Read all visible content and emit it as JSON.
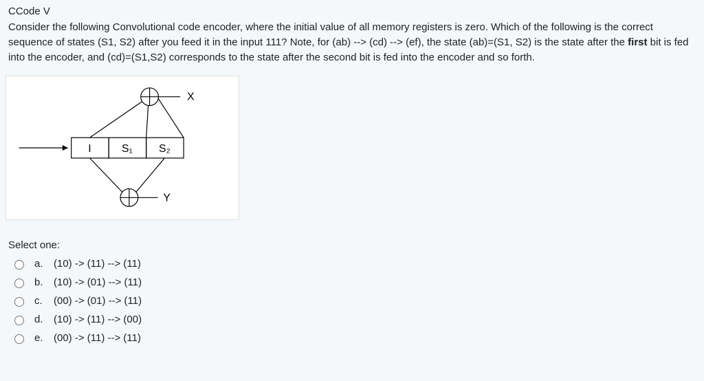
{
  "title": "CCode V",
  "question_html": "Consider the following Convolutional code encoder, where the initial value of all memory registers is zero.  Which of the following is the correct sequence of states (S1, S2) after you feed it in the input 111?   Note, for (ab) --> (cd) --> (ef), the state (ab)=(S1, S2) is the state after the <b>first</b> bit is fed into the encoder, and (cd)=(S1,S2) corresponds to the state after the second bit is fed into the encoder and so forth.",
  "diagram": {
    "input_label": "I",
    "s1_label": "S₁",
    "s2_label": "S₂",
    "x_label": "X",
    "y_label": "Y"
  },
  "select_label": "Select one:",
  "options": [
    {
      "letter": "a.",
      "text": "(10) -> (11) --> (11)"
    },
    {
      "letter": "b.",
      "text": "(10) -> (01) --> (11)"
    },
    {
      "letter": "c.",
      "text": "(00) -> (01) --> (11)"
    },
    {
      "letter": "d.",
      "text": "(10) -> (11) --> (00)"
    },
    {
      "letter": "e.",
      "text": "(00) -> (11) --> (11)"
    }
  ]
}
